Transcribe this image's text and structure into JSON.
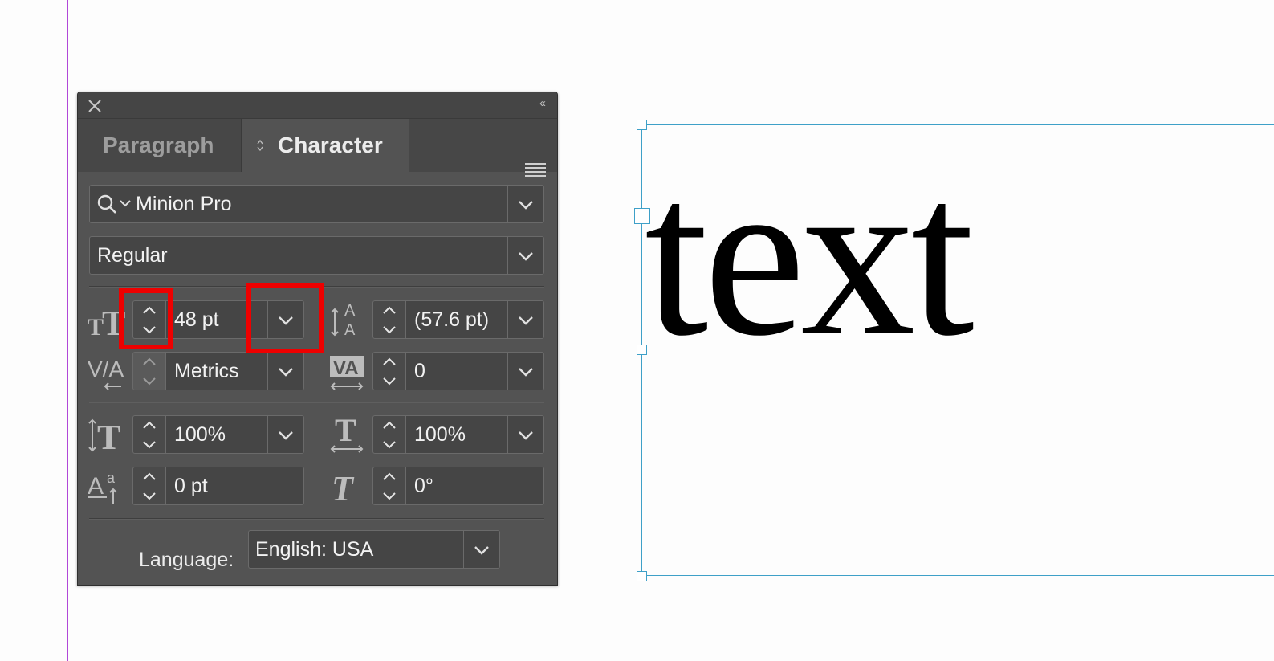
{
  "panel": {
    "tabs": [
      {
        "label": "Paragraph",
        "active": false
      },
      {
        "label": "Character",
        "active": true
      }
    ],
    "font_family": "Minion Pro",
    "font_style": "Regular",
    "font_size": "48 pt",
    "leading": "(57.6 pt)",
    "kerning": "Metrics",
    "tracking": "0",
    "vertical_scale": "100%",
    "horizontal_scale": "100%",
    "baseline_shift": "0 pt",
    "skew": "0°",
    "language_label": "Language:",
    "language": "English: USA"
  },
  "canvas": {
    "text": "text"
  },
  "colors": {
    "highlight": "#ee0000",
    "frame": "#3ea0c8",
    "margin_guide": "#b148d8",
    "panel_bg": "#535353"
  },
  "highlighted_controls": [
    "font-size-stepper",
    "font-size-dropdown"
  ]
}
